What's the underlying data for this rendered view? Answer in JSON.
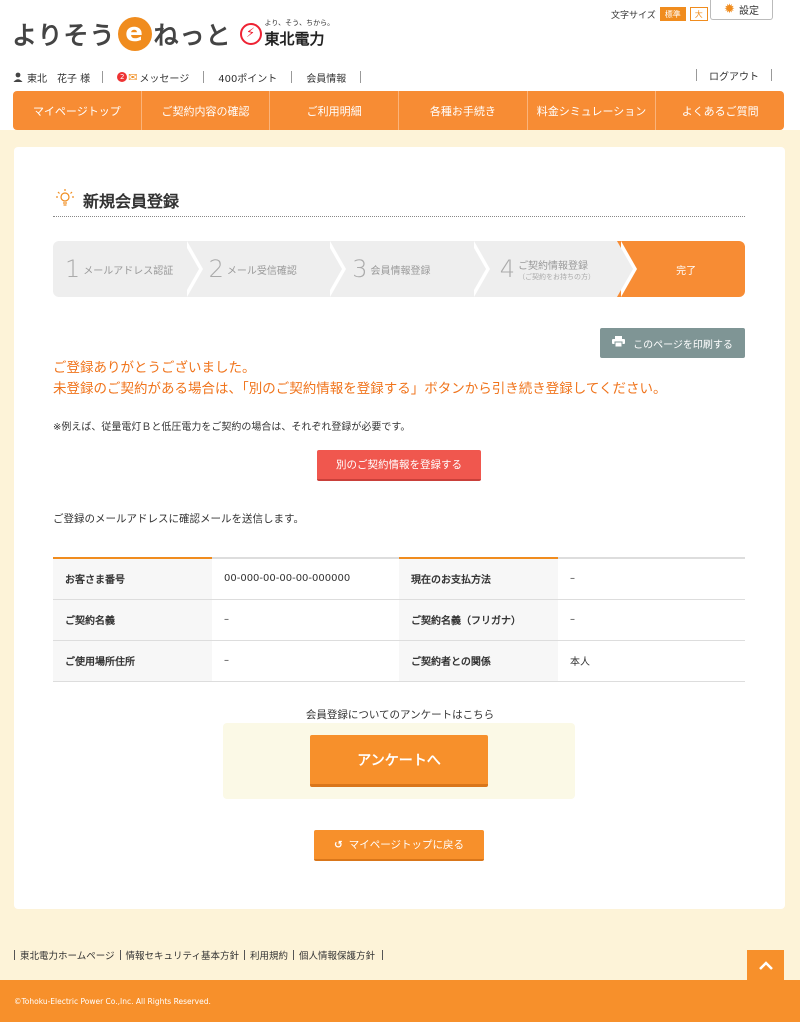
{
  "header": {
    "logo_pre": "よりそう",
    "logo_e": "e",
    "logo_post": "ねっと",
    "brand_tagline": "より、そう、ちから。",
    "brand_name": "東北電力",
    "brand_mark": "⚡",
    "font_size_label": "文字サイズ",
    "font_standard": "標準",
    "font_large": "大",
    "settings_label": "設定"
  },
  "userbar": {
    "user_name": "東北　花子 様",
    "message_count": "2",
    "message_label": "メッセージ",
    "points": "400ポイント",
    "member_info": "会員情報",
    "logout": "ログアウト"
  },
  "nav": [
    "マイページトップ",
    "ご契約内容の確認",
    "ご利用明細",
    "各種お手続き",
    "料金シミュレーション",
    "よくあるご質問"
  ],
  "page_title": "新規会員登録",
  "steps": [
    {
      "num": "1",
      "label": "メールアドレス認証",
      "sub": ""
    },
    {
      "num": "2",
      "label": "メール受信確認",
      "sub": ""
    },
    {
      "num": "3",
      "label": "会員情報登録",
      "sub": ""
    },
    {
      "num": "4",
      "label": "ご契約情報登録",
      "sub": "（ご契約をお持ちの方）"
    },
    {
      "num": "",
      "label": "完了",
      "sub": ""
    }
  ],
  "print_label": "このページを印刷する",
  "thanks_line1": "ご登録ありがとうございました。",
  "thanks_line2": "未登録のご契約がある場合は、「別のご契約情報を登録する」ボタンから引き続き登録してください。",
  "note": "※例えば、従量電灯Ｂと低圧電力をご契約の場合は、それぞれ登録が必要です。",
  "register_other_label": "別のご契約情報を登録する",
  "mail_note": "ご登録のメールアドレスに確認メールを送信します。",
  "info_rows": [
    [
      {
        "k": "お客さま番号",
        "v": "00-000-00-00-00-000000"
      },
      {
        "k": "現在のお支払方法",
        "v": "–"
      }
    ],
    [
      {
        "k": "ご契約名義",
        "v": "–"
      },
      {
        "k": "ご契約名義（フリガナ）",
        "v": "–"
      }
    ],
    [
      {
        "k": "ご使用場所住所",
        "v": "–"
      },
      {
        "k": "ご契約者との関係",
        "v": "本人"
      }
    ]
  ],
  "survey_label": "会員登録についてのアンケートはこちら",
  "survey_button": "アンケートへ",
  "back_button": "マイページトップに戻る",
  "footer_links": [
    "東北電力ホームページ",
    "情報セキュリティ基本方針",
    "利用規約",
    "個人情報保護方針"
  ],
  "copyright": "©Tohoku-Electric Power Co.,Inc. All Rights Reserved.",
  "colors": {
    "accent": "#f78c34",
    "red_button": "#f0574e",
    "print_button": "#7f9595",
    "page_bg": "#fdf3d8"
  }
}
